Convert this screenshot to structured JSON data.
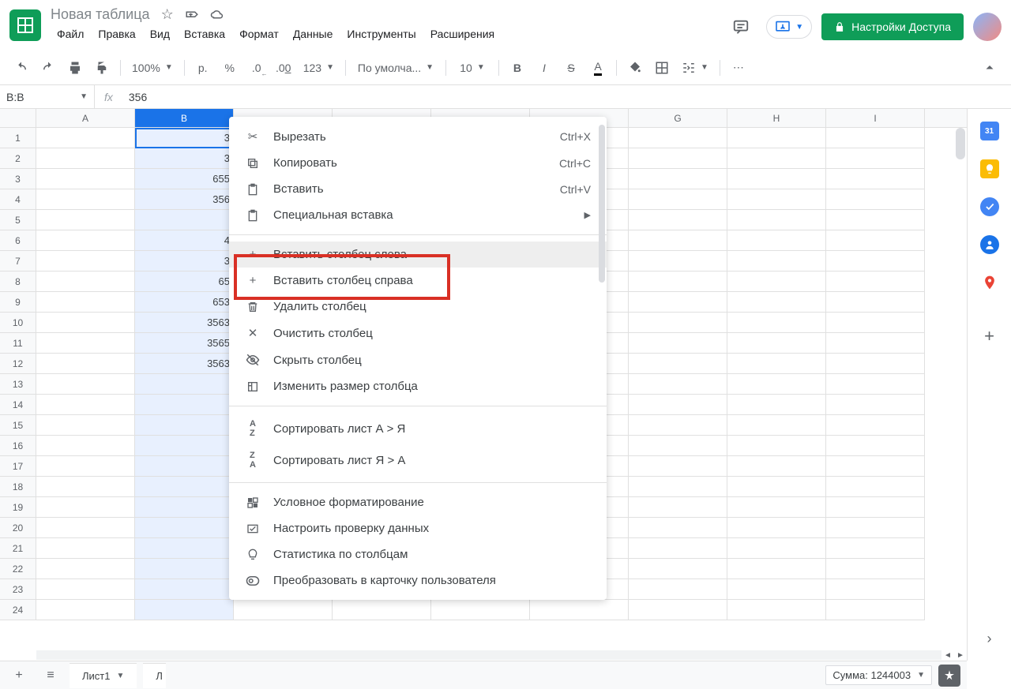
{
  "header": {
    "doc_title": "Новая таблица",
    "menus": [
      "Файл",
      "Правка",
      "Вид",
      "Вставка",
      "Формат",
      "Данные",
      "Инструменты",
      "Расширения"
    ],
    "share_label": "Настройки Доступа"
  },
  "toolbar": {
    "zoom": "100%",
    "currency": "р.",
    "percent": "%",
    "dec_dec": ".0",
    "dec_inc": ".00",
    "num_format": "123",
    "font": "По умолча...",
    "font_size": "10"
  },
  "formula": {
    "name_box": "B:B",
    "value": "356"
  },
  "columns": [
    "A",
    "B",
    "",
    "",
    "",
    "",
    "G",
    "H",
    "I"
  ],
  "selected_col_index": 1,
  "rows": 24,
  "cell_data": {
    "B1": "3",
    "B2": "3",
    "B3": "655",
    "B4": "356",
    "B6": "4",
    "B7": "3",
    "B8": "65",
    "B9": "653",
    "B10": "3563",
    "B11": "3565",
    "B12": "3563"
  },
  "context_menu": {
    "cut": {
      "label": "Вырезать",
      "shortcut": "Ctrl+X"
    },
    "copy": {
      "label": "Копировать",
      "shortcut": "Ctrl+C"
    },
    "paste": {
      "label": "Вставить",
      "shortcut": "Ctrl+V"
    },
    "paste_special": {
      "label": "Специальная вставка"
    },
    "insert_left": {
      "label": "Вставить столбец слева"
    },
    "insert_right": {
      "label": "Вставить столбец справа"
    },
    "delete_col": {
      "label": "Удалить столбец"
    },
    "clear_col": {
      "label": "Очистить столбец"
    },
    "hide_col": {
      "label": "Скрыть столбец"
    },
    "resize_col": {
      "label": "Изменить размер столбца"
    },
    "sort_az": {
      "label": "Сортировать лист А > Я"
    },
    "sort_za": {
      "label": "Сортировать лист Я > А"
    },
    "cond_format": {
      "label": "Условное форматирование"
    },
    "data_validation": {
      "label": "Настроить проверку данных"
    },
    "col_stats": {
      "label": "Статистика по столбцам"
    },
    "convert_card": {
      "label": "Преобразовать в карточку пользователя"
    }
  },
  "sheets": {
    "tab1": "Лист1",
    "tab2_partial": "Л"
  },
  "status": {
    "sum_label": "Сумма: 1244003"
  },
  "side_panel": {
    "calendar_day": "31"
  }
}
